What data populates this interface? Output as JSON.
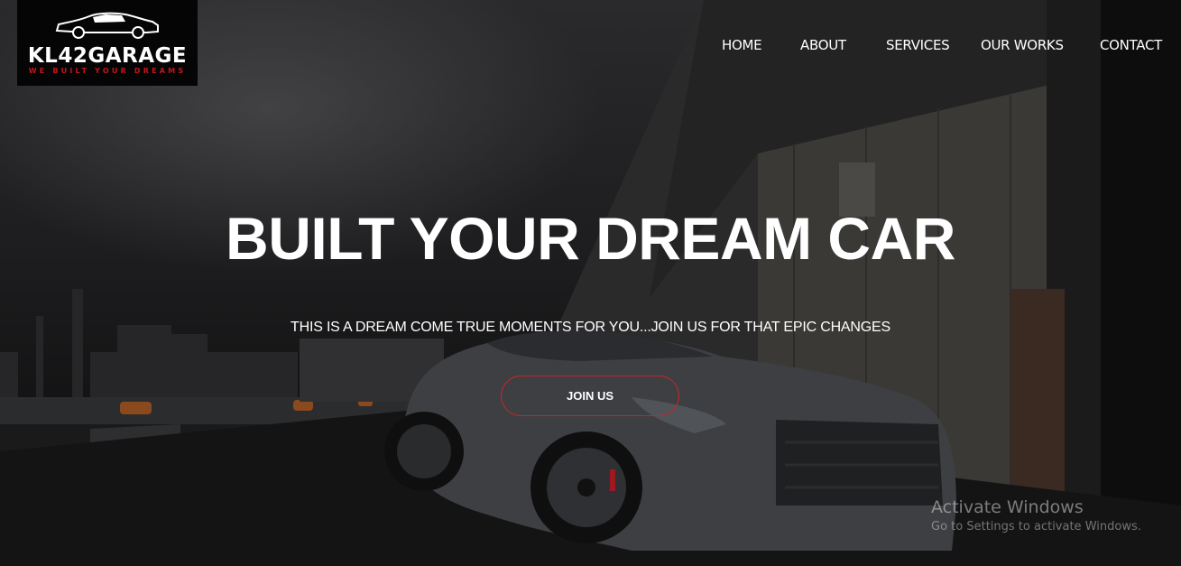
{
  "logo": {
    "name": "KL42GARAGE",
    "tagline": "WE BUILT YOUR DREAMS",
    "icon": "car-silhouette-icon"
  },
  "nav": {
    "items": [
      {
        "label": "HOME"
      },
      {
        "label": "ABOUT"
      },
      {
        "label": "SERVICES"
      },
      {
        "label": "OUR WORKS"
      },
      {
        "label": "CONTACT"
      }
    ]
  },
  "hero": {
    "headline": "BUILT YOUR DREAM CAR",
    "subline": "THIS IS A DREAM COME TRUE MOMENTS FOR YOU...JOIN US FOR THAT EPIC CHANGES",
    "cta_label": "JOIN US",
    "cta_border_color": "#c8262b"
  },
  "watermark": {
    "title": "Activate Windows",
    "subtitle": "Go to Settings to activate Windows."
  }
}
